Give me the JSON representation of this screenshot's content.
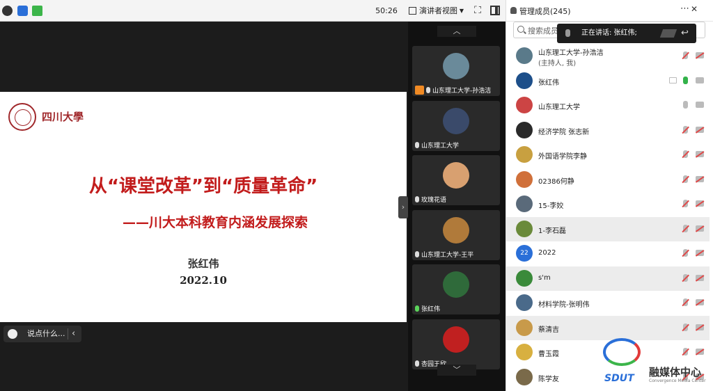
{
  "toolbar": {
    "timer": "50:26",
    "view_label": "演讲者视图",
    "fullscreen_glyph": "⛶"
  },
  "slide": {
    "logo_text": "四川大學",
    "title": "从“课堂改革”到“质量革命”",
    "subtitle": "——川大本科教育内涵发展探索",
    "author": "张红伟",
    "date": "2022.10"
  },
  "chat": {
    "placeholder": "说点什么..."
  },
  "video_tiles": [
    {
      "label": "山东理工大学-孙浩洁",
      "mic": "off",
      "host": true,
      "avatar_color": "#6a8a9a"
    },
    {
      "label": "山东理工大学",
      "mic": "on_white",
      "host": false,
      "avatar_color": "#3a4a6a"
    },
    {
      "label": "玫瑰花语",
      "mic": "off",
      "host": false,
      "avatar_color": "#d8a070"
    },
    {
      "label": "山东理工大学-王平",
      "mic": "off",
      "host": false,
      "avatar_color": "#b07a3a"
    },
    {
      "label": "张红伟",
      "mic": "on",
      "host": false,
      "avatar_color": "#2f6a3a"
    },
    {
      "label": "杏园王欣",
      "mic": "off",
      "host": false,
      "avatar_color": "#c02020"
    }
  ],
  "panel": {
    "title": "管理成员(245)",
    "search_placeholder": "搜索成员",
    "speaking": "正在讲话: 张红伟;",
    "members": [
      {
        "name": "山东理工大学-孙浩洁",
        "sub": "(主持人, 我)",
        "mic": "off",
        "cam": "off",
        "share": false,
        "highlight": false,
        "avatar_color": "#5a7a8a"
      },
      {
        "name": "张红伟",
        "sub": "",
        "mic": "on",
        "cam": "on",
        "share": true,
        "highlight": false,
        "avatar_color": "#1d4f8a"
      },
      {
        "name": "山东理工大学",
        "sub": "",
        "mic": "plain",
        "cam": "on",
        "share": false,
        "highlight": false,
        "avatar_color": "#c44"
      },
      {
        "name": "经济学院 张志新",
        "sub": "",
        "mic": "off",
        "cam": "off",
        "share": false,
        "highlight": false,
        "avatar_color": "#2a2a2a"
      },
      {
        "name": "外国语学院李静",
        "sub": "",
        "mic": "off",
        "cam": "off",
        "share": false,
        "highlight": false,
        "avatar_color": "#c8a040"
      },
      {
        "name": "02386何静",
        "sub": "",
        "mic": "off",
        "cam": "off",
        "share": false,
        "highlight": false,
        "avatar_color": "#d0703a"
      },
      {
        "name": "15-李姣",
        "sub": "",
        "mic": "off",
        "cam": "off",
        "share": false,
        "highlight": false,
        "avatar_color": "#5a6a7a"
      },
      {
        "name": "1-李石磊",
        "sub": "",
        "mic": "off",
        "cam": "off",
        "share": false,
        "highlight": true,
        "avatar_color": "#6a8a3a"
      },
      {
        "name": "2022",
        "sub": "",
        "mic": "off",
        "cam": "off",
        "share": false,
        "highlight": false,
        "avatar_color": "#2a6fd8",
        "avatar_text": "22"
      },
      {
        "name": "s'm",
        "sub": "",
        "mic": "off",
        "cam": "off",
        "share": false,
        "highlight": true,
        "avatar_color": "#3a8a3a"
      },
      {
        "name": "材料学院-张明伟",
        "sub": "",
        "mic": "off",
        "cam": "off",
        "share": false,
        "highlight": false,
        "avatar_color": "#4a6a8a"
      },
      {
        "name": "蔡清吉",
        "sub": "",
        "mic": "off",
        "cam": "off",
        "share": false,
        "highlight": true,
        "avatar_color": "#c89a4a"
      },
      {
        "name": "曹玉霞",
        "sub": "",
        "mic": "off",
        "cam": "off",
        "share": false,
        "highlight": false,
        "avatar_color": "#d8b040"
      },
      {
        "name": "陈学友",
        "sub": "",
        "mic": "off",
        "cam": "off",
        "share": false,
        "highlight": false,
        "avatar_color": "#7a6a4a"
      }
    ]
  },
  "watermark": {
    "brand": "SDUT",
    "name": "融媒体中心",
    "name_en": "Convergence Media Center"
  }
}
